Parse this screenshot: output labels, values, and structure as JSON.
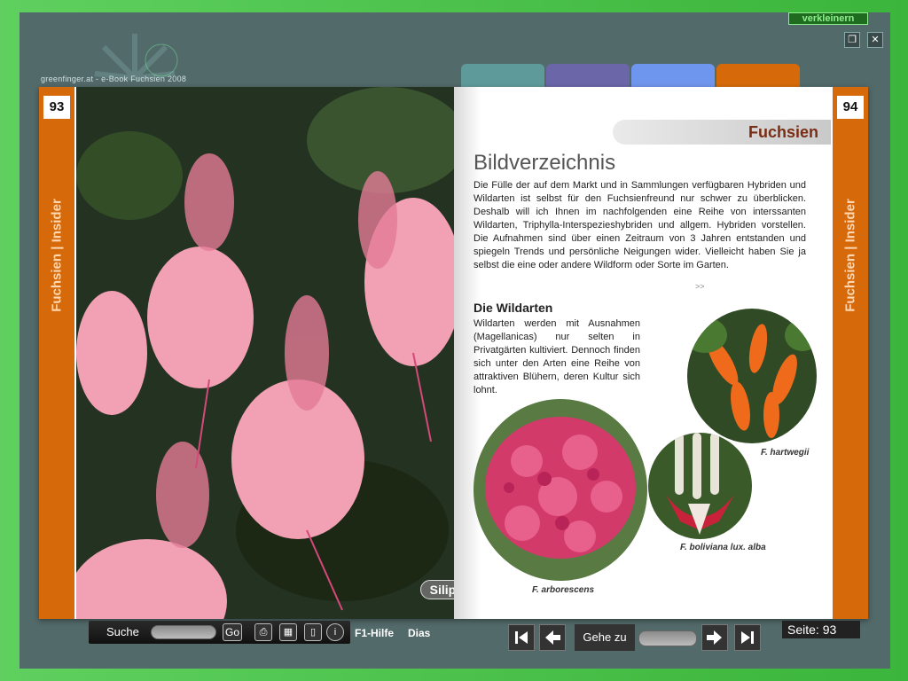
{
  "window": {
    "shrink_label": "verkleinern",
    "restore_icon": "restore-icon",
    "close_icon": "close-icon",
    "brand": "greenfinger.at - e-Book Fuchsien 2008"
  },
  "tabs": [
    {
      "color": "#5f9a9a"
    },
    {
      "color": "#6a66a8"
    },
    {
      "color": "#6f96ee"
    },
    {
      "color": "#d66a0a"
    }
  ],
  "left_page": {
    "number": "93",
    "strip_label": "Fuchsien | Insider",
    "photo_label": "Silipup"
  },
  "right_page": {
    "number": "94",
    "strip_label": "Fuchsien | Insider",
    "header": "Fuchsien",
    "title": "Bildverzeichnis",
    "intro": "Die Fülle der auf dem Markt und in Sammlungen verfügbaren Hybriden und Wildarten ist selbst für den Fuchsienfreund nur schwer zu überblicken. Deshalb will ich Ihnen im nachfolgenden eine Reihe von interssanten Wildarten, Triphylla-Interspezieshybriden und allgem. Hybriden vorstellen. Die Aufnahmen sind über einen Zeitraum von 3 Jahren entstanden und spiegeln Trends und persönliche Neigungen wider. Vielleicht haben Sie ja selbst die eine oder andere Wildform oder Sorte im Garten.",
    "more": ">>",
    "section_title": "Die Wildarten",
    "section_text": "Wildarten werden mit Ausnahmen (Magellanicas) nur selten in Privatgärten kultiviert. Dennoch finden sich unter den Arten eine Reihe von attraktiven Blühern, deren Kultur sich lohnt.",
    "captions": {
      "hartwegii": "F. hartwegii",
      "boliviana": "F. boliviana lux. alba",
      "arborescens": "F. arborescens"
    }
  },
  "toolbar": {
    "search_label": "Suche",
    "go_label": "Go",
    "print_icon": "print-icon",
    "grid_icon": "grid-icon",
    "page_icon": "page-icon",
    "info_icon": "info-icon",
    "help_label": "F1-Hilfe",
    "slides_label": "Dias",
    "first_icon": "first-page-icon",
    "prev_icon": "prev-page-icon",
    "goto_label": "Gehe zu",
    "next_icon": "next-page-icon",
    "last_icon": "last-page-icon",
    "page_label": "Seite: 93"
  }
}
